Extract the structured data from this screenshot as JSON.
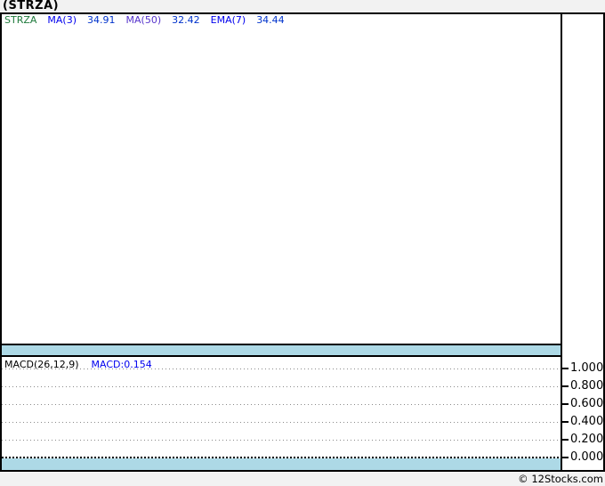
{
  "title": "(STRZA)",
  "main_panel": {
    "legend": [
      {
        "label": "STRZA",
        "color": "#1f7a3c"
      },
      {
        "label": "MA(3)",
        "color": "#0000ee"
      },
      {
        "label": "34.91",
        "color": "#0033cc"
      },
      {
        "label": "MA(50)",
        "color": "#5533cc"
      },
      {
        "label": "32.42",
        "color": "#0033cc"
      },
      {
        "label": "EMA(7)",
        "color": "#0000ee"
      },
      {
        "label": "34.44",
        "color": "#0033cc"
      }
    ]
  },
  "macd_panel": {
    "legend_name": "MACD(26,12,9)",
    "legend_value": "MACD:0.154",
    "axis_labels": [
      "1.000",
      "0.800",
      "0.600",
      "0.400",
      "0.200",
      "0.000"
    ]
  },
  "footer": {
    "copyright": "© 12Stocks.com"
  },
  "colors": {
    "page_background": "#f2f2f2",
    "panel_background": "#ffffff",
    "border": "#000000",
    "date_band": "#add9e6",
    "gridline": "#8a8a8a",
    "ticker_green": "#1f7a3c",
    "indicator_blue": "#0000ee",
    "indicator_violet": "#5533cc",
    "value_blue": "#0033cc"
  },
  "chart_data": [
    {
      "type": "line",
      "panel": "price",
      "title": "(STRZA)",
      "series": [
        {
          "name": "STRZA",
          "values": []
        },
        {
          "name": "MA(3)",
          "last_value": 34.91,
          "values": []
        },
        {
          "name": "MA(50)",
          "last_value": 32.42,
          "values": []
        },
        {
          "name": "EMA(7)",
          "last_value": 34.44,
          "values": []
        }
      ],
      "grid": false,
      "legend_position": "top-left",
      "note": "panel is empty - no plotted price data or axis labels visible"
    },
    {
      "type": "line",
      "panel": "indicator",
      "title": "MACD(26,12,9)",
      "series": [
        {
          "name": "MACD",
          "last_value": 0.154,
          "values": []
        }
      ],
      "ylim": [
        0.0,
        1.0
      ],
      "yticks": [
        0.0,
        0.2,
        0.4,
        0.6,
        0.8,
        1.0
      ],
      "ytick_labels": [
        "0.000",
        "0.200",
        "0.400",
        "0.600",
        "0.800",
        "1.000"
      ],
      "grid": true,
      "gridline_style": "dotted",
      "zero_line": true,
      "legend_position": "top-left",
      "note": "no plotted indicator line visible"
    }
  ]
}
